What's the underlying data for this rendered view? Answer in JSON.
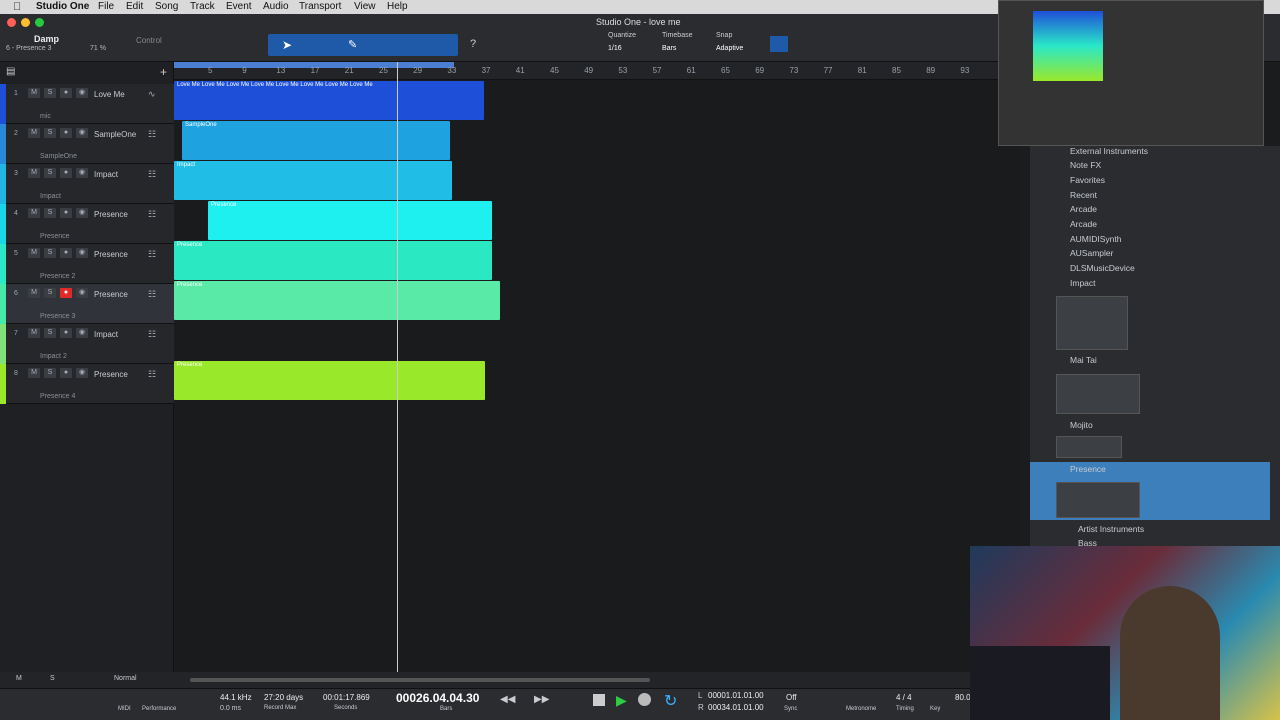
{
  "menubar": {
    "app": "Studio One",
    "items": [
      "File",
      "Edit",
      "Song",
      "Track",
      "Event",
      "Audio",
      "Transport",
      "View",
      "Help"
    ],
    "title": "Studio One - love me"
  },
  "toolbar": {
    "preset": "Damp",
    "track": "6 - Presence 3",
    "zoom": "71 %",
    "control": "Control",
    "quantize_label": "Quantize",
    "quantize": "1/16",
    "timebase_label": "Timebase",
    "timebase": "Bars",
    "snap_label": "Snap",
    "snap": "Adaptive"
  },
  "ruler": [
    "5",
    "9",
    "13",
    "17",
    "21",
    "25",
    "29",
    "33",
    "37",
    "41",
    "45",
    "49",
    "53",
    "57",
    "61",
    "65",
    "69",
    "73",
    "77",
    "81",
    "85",
    "89",
    "93"
  ],
  "tracks": [
    {
      "num": "1",
      "name": "Love Me",
      "inst": "mic",
      "color": "#1e4fd8"
    },
    {
      "num": "2",
      "name": "SampleOne",
      "inst": "SampleOne",
      "color": "#2a88d8"
    },
    {
      "num": "3",
      "name": "Impact",
      "inst": "Impact",
      "color": "#22b5e2"
    },
    {
      "num": "4",
      "name": "Presence",
      "inst": "Presence",
      "color": "#18d8e8"
    },
    {
      "num": "5",
      "name": "Presence",
      "inst": "Presence 2",
      "color": "#2ae8c8"
    },
    {
      "num": "6",
      "name": "Presence",
      "inst": "Presence 3",
      "color": "#48e8a8"
    },
    {
      "num": "7",
      "name": "Impact",
      "inst": "Impact 2",
      "color": "#80e07a"
    },
    {
      "num": "8",
      "name": "Presence",
      "inst": "Presence 4",
      "color": "#9ae82a"
    }
  ],
  "clips": [
    {
      "label": "Love Me Love Me Love Me Love Me Love Me Love Me Love Me Love Me",
      "color": "#1e4fd8"
    },
    {
      "label": "SampleOne",
      "color": "#1fa3e0"
    },
    {
      "label": "Impact",
      "color": "#20bde6"
    },
    {
      "label": "Presence",
      "color": "#1ef0f0"
    },
    {
      "label": "Presence",
      "color": "#2ae8c2"
    },
    {
      "label": "Presence",
      "color": "#5aeaa8"
    },
    {
      "label": "Presence",
      "color": "#9ae82a"
    }
  ],
  "browser": {
    "items": [
      "External Instruments",
      "Note FX",
      "Favorites",
      "Recent",
      "Arcade",
      "Arcade",
      "AUMIDISynth",
      "AUSampler",
      "DLSMusicDevice",
      "Impact",
      "Mai Tai",
      "Mojito",
      "Presence",
      "Artist Instruments",
      "Bass"
    ]
  },
  "transport": {
    "samplerate": "44.1 kHz",
    "latency": "0.0 ms",
    "days": "27:20 days",
    "record_max": "Record Max",
    "seconds_val": "00:01:17.869",
    "seconds": "Seconds",
    "bars_val": "00026.04.04.30",
    "bars": "Bars",
    "loop_l": "00001.01.01.00",
    "loop_r": "00034.01.01.00",
    "off": "Off",
    "sync": "Sync",
    "metronome": "Metronome",
    "timing": "4 / 4",
    "timing_label": "Timing",
    "key": "Key",
    "tempo": "80.0",
    "midi": "MIDI",
    "performance": "Performance",
    "normal": "Normal",
    "m": "M",
    "s": "S",
    "L": "L",
    "R": "R"
  }
}
